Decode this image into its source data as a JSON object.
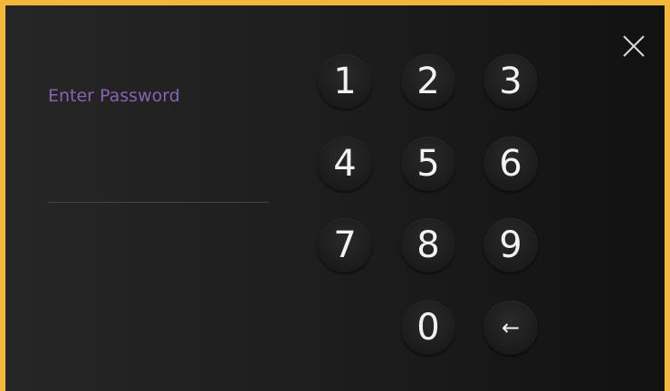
{
  "dialog": {
    "prompt": "Enter Password",
    "password_value": "",
    "close_icon": "close-icon",
    "accent_color": "#f3b73a",
    "prompt_color": "#8a62b3"
  },
  "keypad": {
    "keys": [
      "1",
      "2",
      "3",
      "4",
      "5",
      "6",
      "7",
      "8",
      "9",
      "0"
    ],
    "backspace_label": "←",
    "backspace_icon": "backspace-arrow-icon"
  }
}
